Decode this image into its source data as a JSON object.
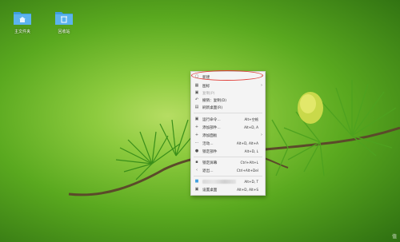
{
  "desktop": {
    "icons": [
      {
        "label": "主文件夹",
        "icon": "home-folder-icon"
      },
      {
        "label": "回收站",
        "icon": "trash-folder-icon"
      }
    ]
  },
  "context_menu": {
    "items": [
      {
        "label": "新建",
        "shortcut": "",
        "submenu": true,
        "disabled": false,
        "icon": "new-document-icon"
      },
      {
        "label": "图标",
        "shortcut": "",
        "submenu": true,
        "disabled": false,
        "icon": "icons-grid-icon"
      },
      {
        "label": "复制(P)",
        "shortcut": "",
        "submenu": false,
        "disabled": true,
        "icon": "paste-icon"
      },
      {
        "label": "撤销：复制(D)",
        "shortcut": "",
        "submenu": false,
        "disabled": false,
        "icon": "undo-icon"
      },
      {
        "label": "刷新桌面(R)",
        "shortcut": "",
        "submenu": false,
        "disabled": false,
        "icon": "refresh-icon"
      },
      {
        "label": "运行命令...",
        "shortcut": "Alt+空格",
        "submenu": false,
        "disabled": false,
        "icon": "run-command-icon"
      },
      {
        "label": "添加部件...",
        "shortcut": "Alt+D, A",
        "submenu": false,
        "disabled": false,
        "icon": "add-widget-icon"
      },
      {
        "label": "添加面板",
        "shortcut": "",
        "submenu": true,
        "disabled": false,
        "icon": "add-panel-icon"
      },
      {
        "label": "活动...",
        "shortcut": "Alt+D, Alt+A",
        "submenu": false,
        "disabled": false,
        "icon": "activities-icon"
      },
      {
        "label": "锁定部件",
        "shortcut": "Alt+D, L",
        "submenu": false,
        "disabled": false,
        "icon": "lock-widgets-icon"
      },
      {
        "label": "锁定屏幕",
        "shortcut": "Ctrl+Alt+L",
        "submenu": false,
        "disabled": false,
        "icon": "lock-screen-icon"
      },
      {
        "label": "退出...",
        "shortcut": "Ctrl+Alt+Del",
        "submenu": false,
        "disabled": false,
        "icon": "logout-icon"
      },
      {
        "label": "",
        "shortcut": "Alt+D, T",
        "submenu": false,
        "disabled": false,
        "icon": "folder-view-icon",
        "blurred": true
      },
      {
        "label": "设置桌面",
        "shortcut": "Alt+D, Alt+S",
        "submenu": false,
        "disabled": false,
        "icon": "desktop-settings-icon"
      }
    ]
  },
  "watermark": "值",
  "colors": {
    "highlight": "#e0403a",
    "menu_bg": "#f4f4f4",
    "folder_blue": "#3f9fe0"
  }
}
